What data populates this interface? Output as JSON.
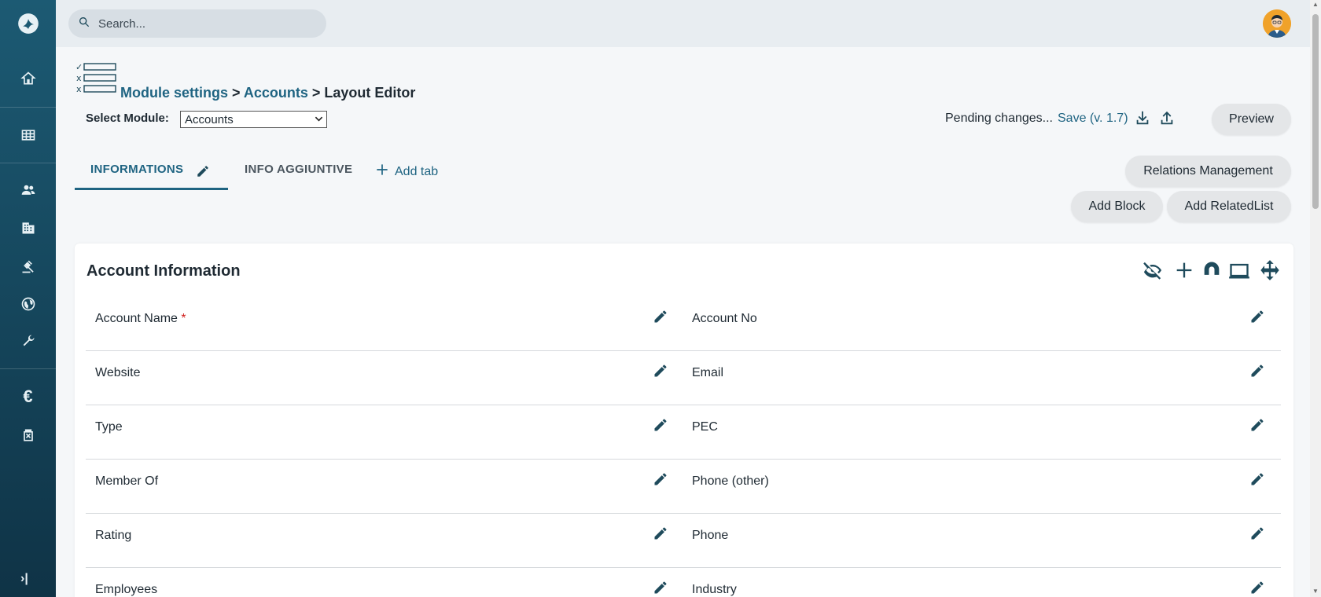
{
  "search": {
    "placeholder": "Search..."
  },
  "breadcrumb": {
    "part1": "Module settings",
    "sep1": " > ",
    "part2": "Accounts",
    "sep2": " > ",
    "part3": "Layout Editor"
  },
  "module_select": {
    "label": "Select Module:",
    "value": "Accounts"
  },
  "status": {
    "pending": "Pending changes...",
    "save": "Save (v. 1.7)"
  },
  "buttons": {
    "preview": "Preview",
    "relations": "Relations Management",
    "add_block": "Add Block",
    "add_relatedlist": "Add RelatedList"
  },
  "tabs": [
    {
      "label": "INFORMATIONS"
    },
    {
      "label": "INFO AGGIUNTIVE"
    }
  ],
  "add_tab": "Add tab",
  "block": {
    "title": "Account Information",
    "fields": [
      {
        "left": "Account Name",
        "left_required": "*",
        "right": "Account No"
      },
      {
        "left": "Website",
        "right": "Email"
      },
      {
        "left": "Type",
        "right": "PEC"
      },
      {
        "left": "Member Of",
        "right": "Phone (other)"
      },
      {
        "left": "Rating",
        "right": "Phone"
      },
      {
        "left": "Employees",
        "right": "Industry"
      }
    ]
  },
  "colors": {
    "sidebar": "#1c5a73",
    "accent": "#1f6482",
    "required": "#d0201d"
  },
  "sidebar_icons": [
    "logo-icon",
    "home-icon",
    "grid-icon",
    "contacts-icon",
    "building-icon",
    "gavel-icon",
    "globe-icon",
    "wrench-icon",
    "euro-icon",
    "trash-icon",
    "collapse-icon"
  ]
}
